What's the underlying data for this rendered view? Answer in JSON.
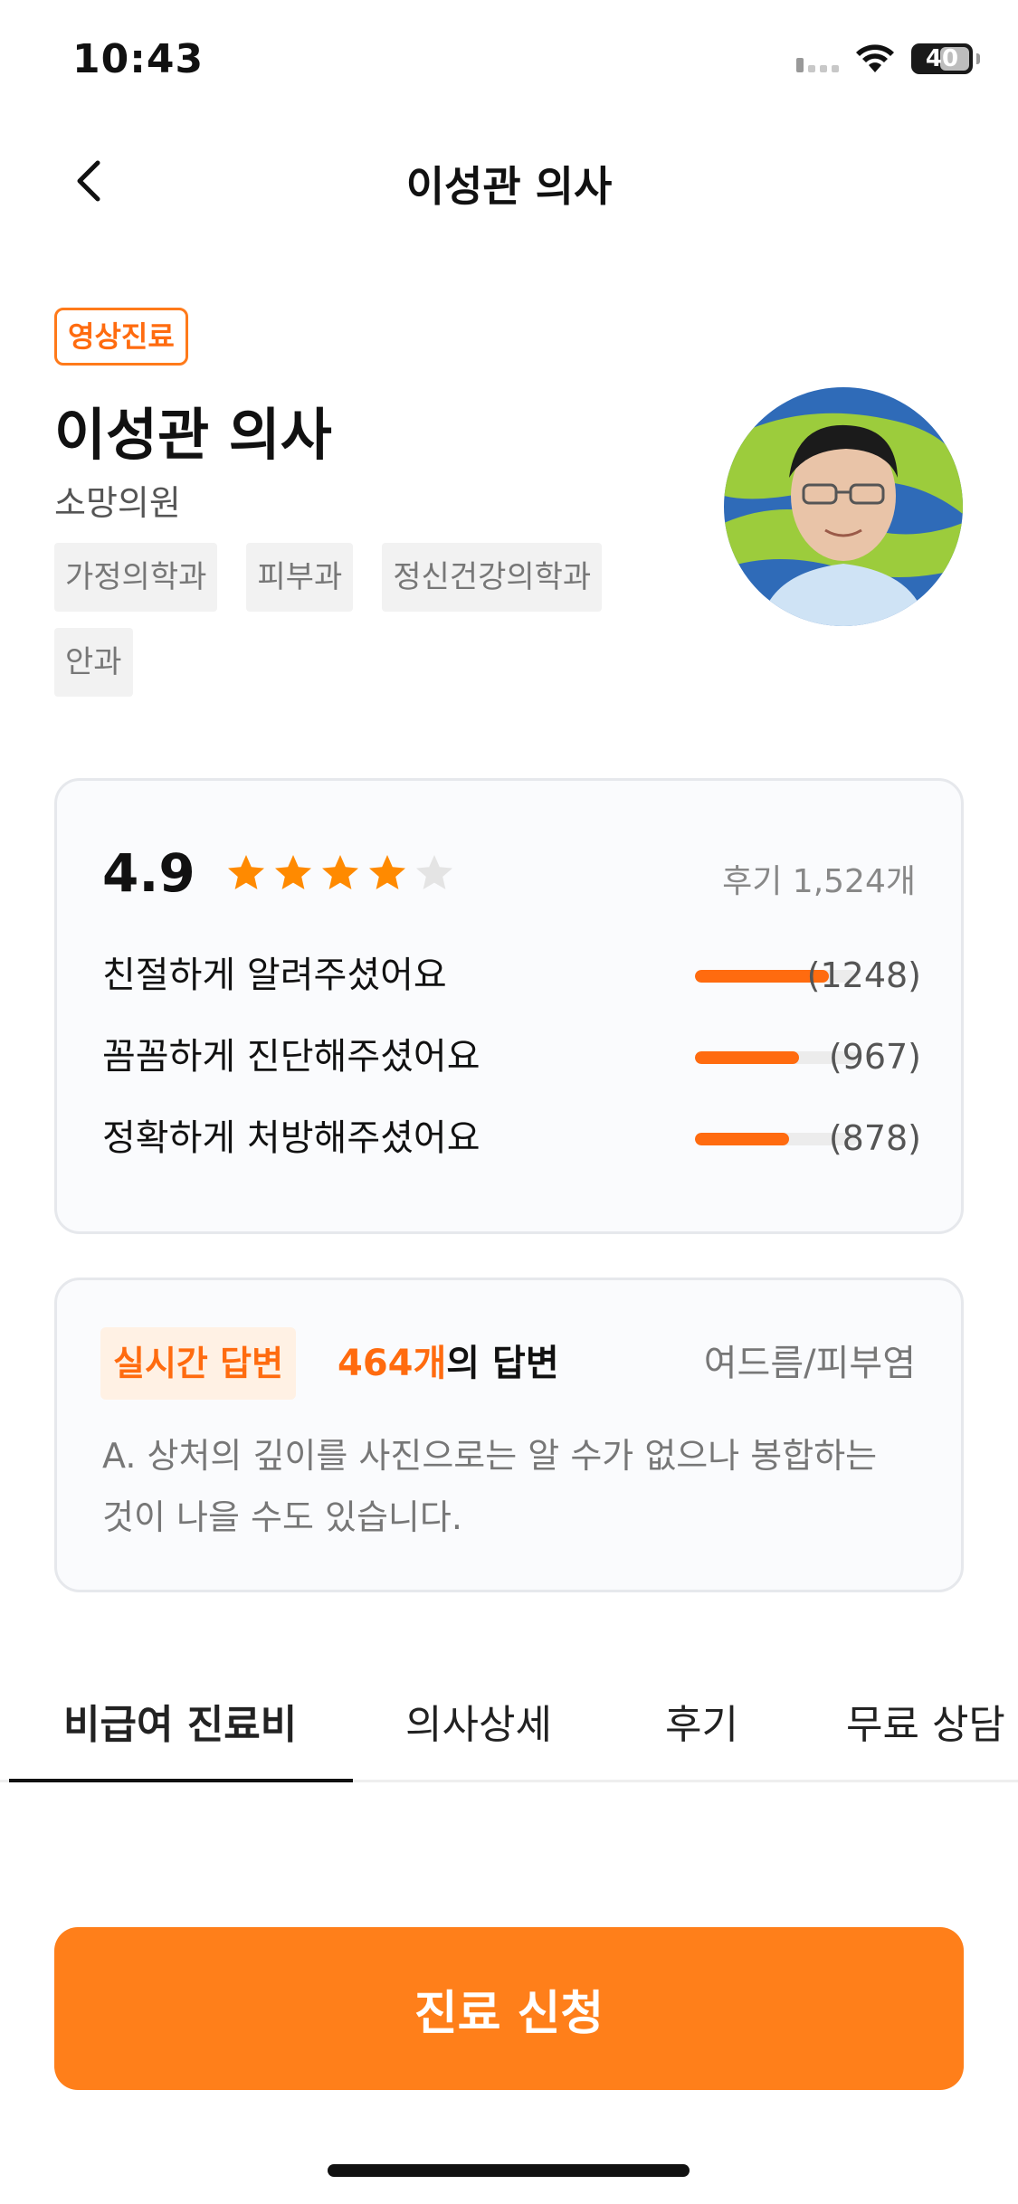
{
  "status_bar": {
    "time": "10:43",
    "battery": "40"
  },
  "nav": {
    "title": "이성관 의사"
  },
  "profile": {
    "badge": "영상진료",
    "name": "이성관 의사",
    "clinic": "소망의원",
    "tags": [
      "가정의학과",
      "피부과",
      "정신건강의학과",
      "안과"
    ]
  },
  "rating": {
    "score": "4.9",
    "stars_filled": 4,
    "stars_total": 5,
    "review_count": "후기 1,524개",
    "rows": [
      {
        "label": "친절하게 알려주셨어요",
        "count": "(1248)",
        "fraction": 0.82
      },
      {
        "label": "꼼꼼하게 진단해주셨어요",
        "count": "(967)",
        "fraction": 0.64
      },
      {
        "label": "정확하게 처방해주셨어요",
        "count": "(878)",
        "fraction": 0.58
      }
    ]
  },
  "answer": {
    "live_badge": "실시간 답변",
    "count_num": "464개",
    "count_suffix": "의 답변",
    "category": "여드름/피부염",
    "text": "A. 상처의 깊이를 사진으로는 알 수가 없으나 봉합하는 것이 나을 수도 있습니다."
  },
  "tabs": [
    "비급여 진료비",
    "의사상세",
    "후기",
    "무료 상담"
  ],
  "cta": {
    "label": "진료 신청"
  },
  "colors": {
    "accent": "#ff7f1a",
    "accent_text": "#ff6b0f"
  }
}
